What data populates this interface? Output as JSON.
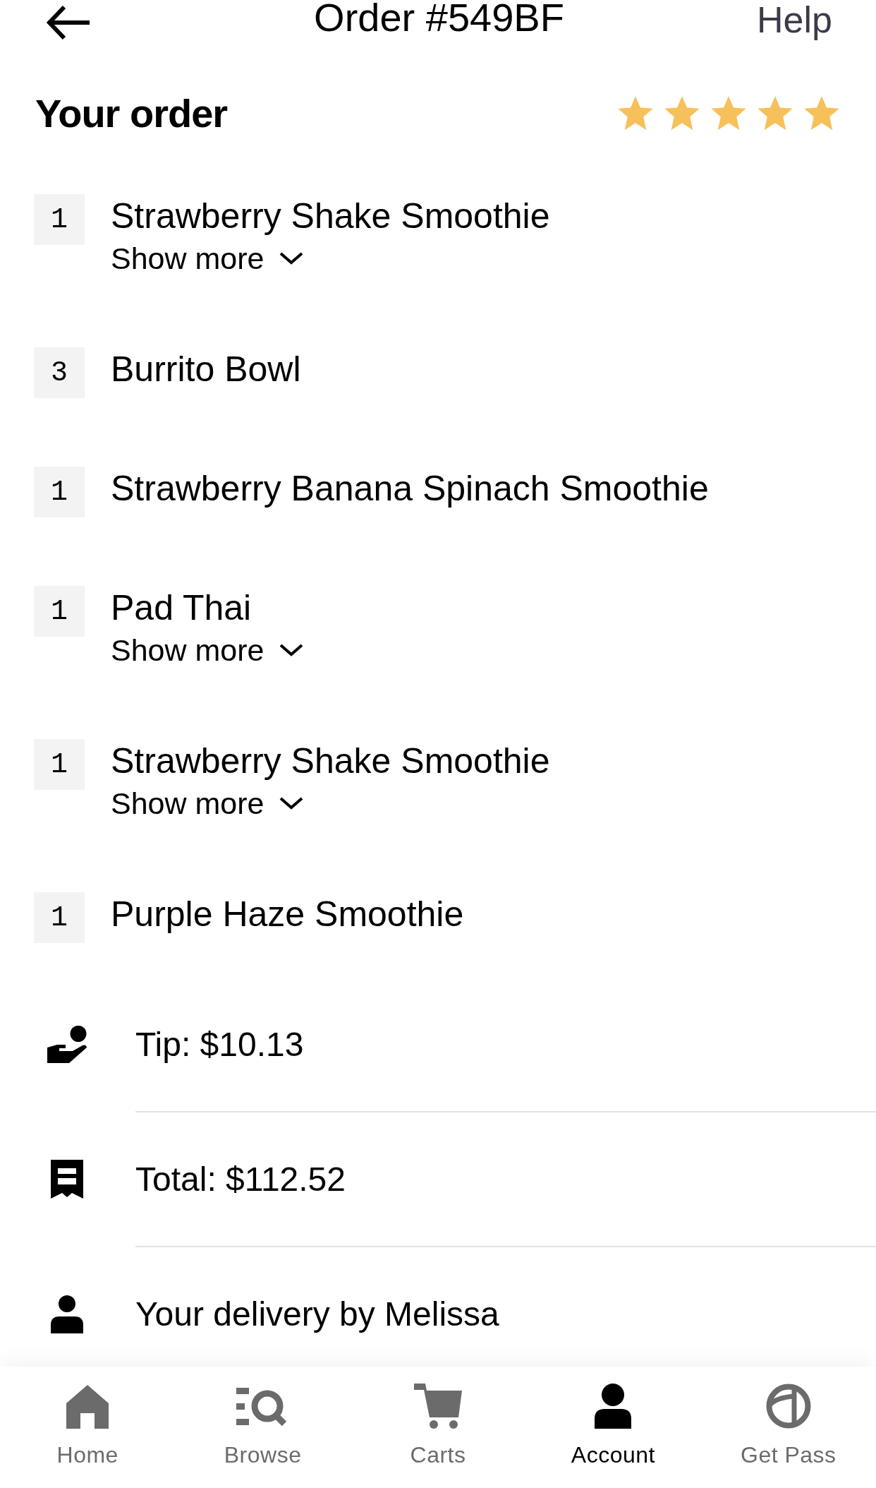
{
  "header": {
    "title": "Order #549BF",
    "help": "Help"
  },
  "order": {
    "heading": "Your order",
    "stars": 5
  },
  "items": [
    {
      "quantity": "1",
      "name": "Strawberry Shake Smoothie",
      "more": "Show more"
    },
    {
      "quantity": "3",
      "name": "Burrito Bowl"
    },
    {
      "quantity": "1",
      "name": "Strawberry Banana Spinach Smoothie"
    },
    {
      "quantity": "1",
      "name": "Pad Thai",
      "more": "Show more"
    },
    {
      "quantity": "1",
      "name": "Strawberry Shake Smoothie",
      "more": "Show more"
    },
    {
      "quantity": "1",
      "name": "Purple Haze Smoothie"
    }
  ],
  "summary": [
    {
      "kind": "tip",
      "text": "Tip: $10.13"
    },
    {
      "kind": "total",
      "text": "Total: $112.52"
    },
    {
      "kind": "courier",
      "text": "Your delivery by Melissa"
    }
  ],
  "nav": [
    {
      "kind": "home",
      "label": "Home",
      "selected": false
    },
    {
      "kind": "browse",
      "label": "Browse",
      "selected": false
    },
    {
      "kind": "cart",
      "label": "Carts",
      "selected": false
    },
    {
      "kind": "account",
      "label": "Account",
      "selected": true
    },
    {
      "kind": "pass",
      "label": "Get Pass",
      "selected": false
    }
  ]
}
